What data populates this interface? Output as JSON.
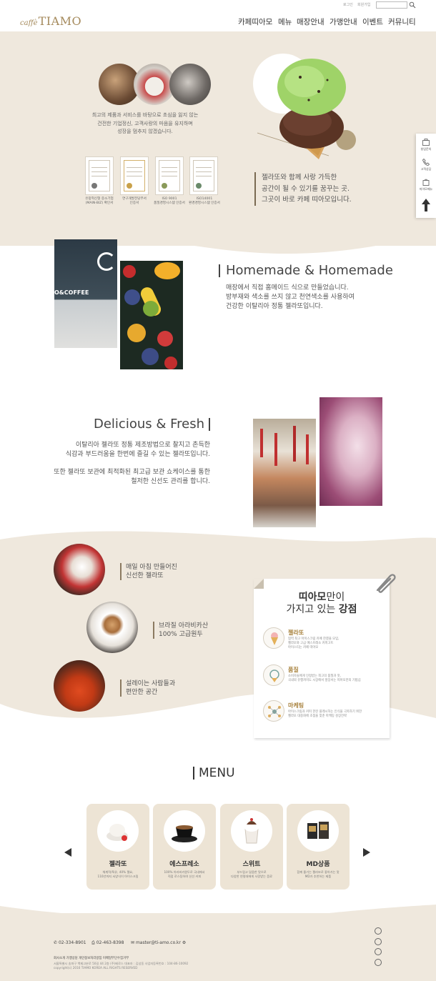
{
  "header": {
    "logo_script": "caffè",
    "logo_name": "TIAMO",
    "util_login": "로그인",
    "util_join": "회원가입",
    "search_placeholder": "",
    "nav": [
      "카페띠아모",
      "메뉴",
      "매장안내",
      "가맹안내",
      "이벤트",
      "커뮤니티"
    ]
  },
  "intro": {
    "text": [
      "최고의 제품과 서비스를 바탕으로 초심을 잃지 않는",
      "건전한 기업정신, 고객사랑의 마음을 유지하며",
      "성장을 멈추지 않겠습니다."
    ],
    "certs": [
      {
        "caption": [
          "유망혁신형 중소기업",
          "(MAIN-BIZ) 확인서"
        ]
      },
      {
        "caption": [
          "연구개발전담부서",
          "인증서"
        ]
      },
      {
        "caption": [
          "ISO 9001",
          "품질경영시스템 인증서"
        ]
      },
      {
        "caption": [
          "ISO14001",
          "환경경영시스템 인증서"
        ]
      }
    ],
    "quote": [
      "젤라또와 함께 사랑 가득한",
      "공간이 될 수 있기를 꿈꾸는 곳.",
      "그곳이 바로 카페 띠아모입니다."
    ]
  },
  "homemade": {
    "title": "Homemade & Homemade",
    "text": [
      "매장에서 직접 홈메이드 식으로 만들었습니다.",
      "방부재와 색소를 쓰지 않고 천연색소를 사용하여",
      "건강한 이탈리아 정통 젤라또입니다."
    ],
    "sign_text": "O&COFFEE"
  },
  "fresh": {
    "title": "Delicious & Fresh",
    "text1": [
      "이탈리아 젤라또 정통 제조방법으로 찰지고 촌득한",
      "식감과 부드러움을 한번에 즐길 수 있는 젤라또입니다."
    ],
    "text2": [
      "또한 젤라또 보관에 최적화된 최고급 보관 쇼케이스를 통한",
      "철저한 신선도 관리를 합니다."
    ]
  },
  "strengths": {
    "items": [
      {
        "lines": [
          "매일 아침 만들어진",
          "신선한 젤라또"
        ]
      },
      {
        "lines": [
          "브라질 아라비카산",
          "100% 고급원두"
        ]
      },
      {
        "lines": [
          "설레이는 사람들과",
          "편안한 공간"
        ]
      }
    ],
    "paper_title_1a": "띠아모",
    "paper_title_1b": "만이",
    "paper_title_2a": "가지고 있는 ",
    "paper_title_2b": "강점",
    "rows": [
      {
        "title": "젤라또",
        "desc": [
          "협력 최고 아이스크림 카페 한결을 모입,",
          "젤라또와 고급 에스프레소 커피고트",
          "아이스티는 카페 띠아모"
        ]
      },
      {
        "title": "품질",
        "desc": [
          "소비자들에게 인정받는 최고의 품질과 맛,",
          "국내외 유행까지도 시장에서 앞장서는 띠아모만의 기법심"
        ]
      },
      {
        "title": "마케팅",
        "desc": [
          "아이스크림과 커피 한잔 플래시하는 인식을 극복하기 위한",
          "젤라또 대중화에 초점을 맞춘 마케팅 성장전략"
        ]
      }
    ]
  },
  "menu": {
    "title": "MENU",
    "cards": [
      {
        "name": "젤라또",
        "desc": [
          "체계적/특유, 40% 젤요,",
          "110년까지 서양식이 아이스크림"
        ]
      },
      {
        "name": "에스프레소",
        "desc": [
          "100% 아라비카원두로 국내에서",
          "직접 로스팅하여 신선 커피"
        ]
      },
      {
        "name": "스위트",
        "desc": [
          "부드럽고 달콤한 맛으로",
          "다양한 연령대에게 사랑받는 음료"
        ]
      },
      {
        "name": "MD상품",
        "desc": [
          "함께 즐기는 젤라또로 좋아가는 맛",
          "MD가 추천하는 제품"
        ]
      }
    ]
  },
  "footer": {
    "phone": "02-334-8901",
    "fax": "02-463-8398",
    "email": "master@ti-amo.co.kr",
    "links": "회사소개   가맹상담   개인정보처리방침   이메일무단수집거부",
    "address": "서울특별시 송파구 백제고분로 50길 44 2층 (주)베로스   대표자 : 김성동   사업자등록번호 : 104-86-10092",
    "copyright": "copyright(c) 2016 TIAMO KOREA ALL RIGHTS RESERVED"
  },
  "quick": {
    "items": [
      "창업문의",
      "고객상담",
      "띠아모메뉴"
    ]
  },
  "colors": {
    "beige": "#efe8dd",
    "accent_gold": "#a8823e",
    "text_dark": "#333333"
  }
}
